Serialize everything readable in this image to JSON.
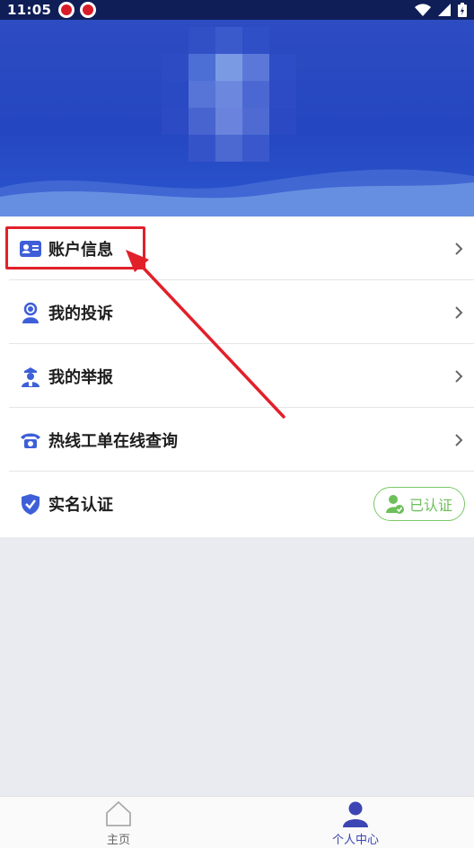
{
  "status_bar": {
    "time": "11:05",
    "notification_icons": [
      "app-notification-icon",
      "app-notification-icon"
    ],
    "right_icons": [
      "wifi-icon",
      "signal-icon",
      "battery-icon"
    ]
  },
  "header": {
    "avatar": "blurred-avatar",
    "colors": {
      "primary": "#2446c0",
      "wave": "#5c86dd"
    }
  },
  "menu": {
    "items": [
      {
        "label": "账户信息",
        "icon": "id-card-icon"
      },
      {
        "label": "我的投诉",
        "icon": "person-icon"
      },
      {
        "label": "我的举报",
        "icon": "officer-icon"
      },
      {
        "label": "热线工单在线查询",
        "icon": "telephone-icon"
      },
      {
        "label": "实名认证",
        "icon": "shield-check-icon",
        "badge": "已认证"
      }
    ],
    "icon_color": "#3e5fd8",
    "badge_color": "#6dbf5a"
  },
  "annotation": {
    "color": "#e2202a"
  },
  "bottom_nav": {
    "items": [
      {
        "label": "主页",
        "icon": "home-icon",
        "active": false
      },
      {
        "label": "个人中心",
        "icon": "user-icon",
        "active": true
      }
    ],
    "active_color": "#3c45b3"
  }
}
